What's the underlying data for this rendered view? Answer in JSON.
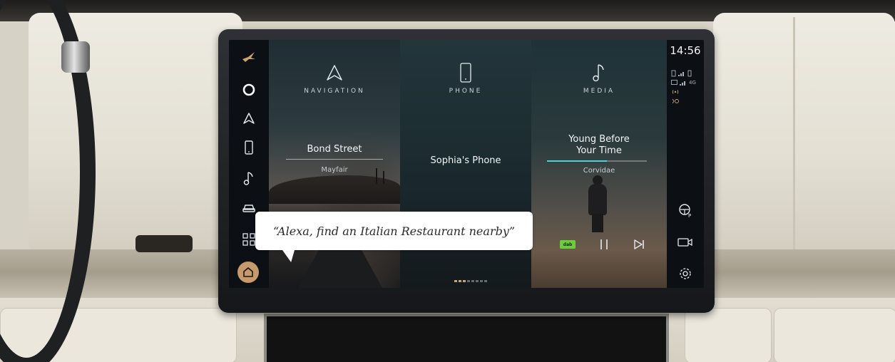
{
  "status": {
    "time": "14:56",
    "network": "4G"
  },
  "sidebar": {
    "items": [
      {
        "icon": "brand-bird-icon"
      },
      {
        "icon": "alexa-icon"
      },
      {
        "icon": "navigation-arrow-icon"
      },
      {
        "icon": "phone-icon"
      },
      {
        "icon": "music-note-icon"
      },
      {
        "icon": "car-icon"
      },
      {
        "icon": "apps-grid-icon"
      },
      {
        "icon": "home-icon"
      }
    ]
  },
  "cards": {
    "navigation": {
      "label": "NAVIGATION",
      "title": "Bond Street",
      "subtitle": "Mayfair"
    },
    "phone": {
      "label": "PHONE",
      "title": "Sophia's Phone"
    },
    "media": {
      "label": "MEDIA",
      "title_line1": "Young Before",
      "title_line2": "Your Time",
      "artist": "Corvidae",
      "progress": 0.6,
      "source_badge": "dab"
    }
  },
  "pagination": {
    "count": 8,
    "active": 3
  },
  "right_bar": {
    "icons": [
      "parking-assist-icon",
      "camera-icon",
      "settings-gear-icon"
    ]
  },
  "voice_prompt": {
    "text": "“Alexa, find an Italian Restaurant nearby”"
  },
  "colors": {
    "accent_home": "#c79a6c",
    "progress": "#4fd1d9",
    "dab": "#6ecb3e"
  }
}
